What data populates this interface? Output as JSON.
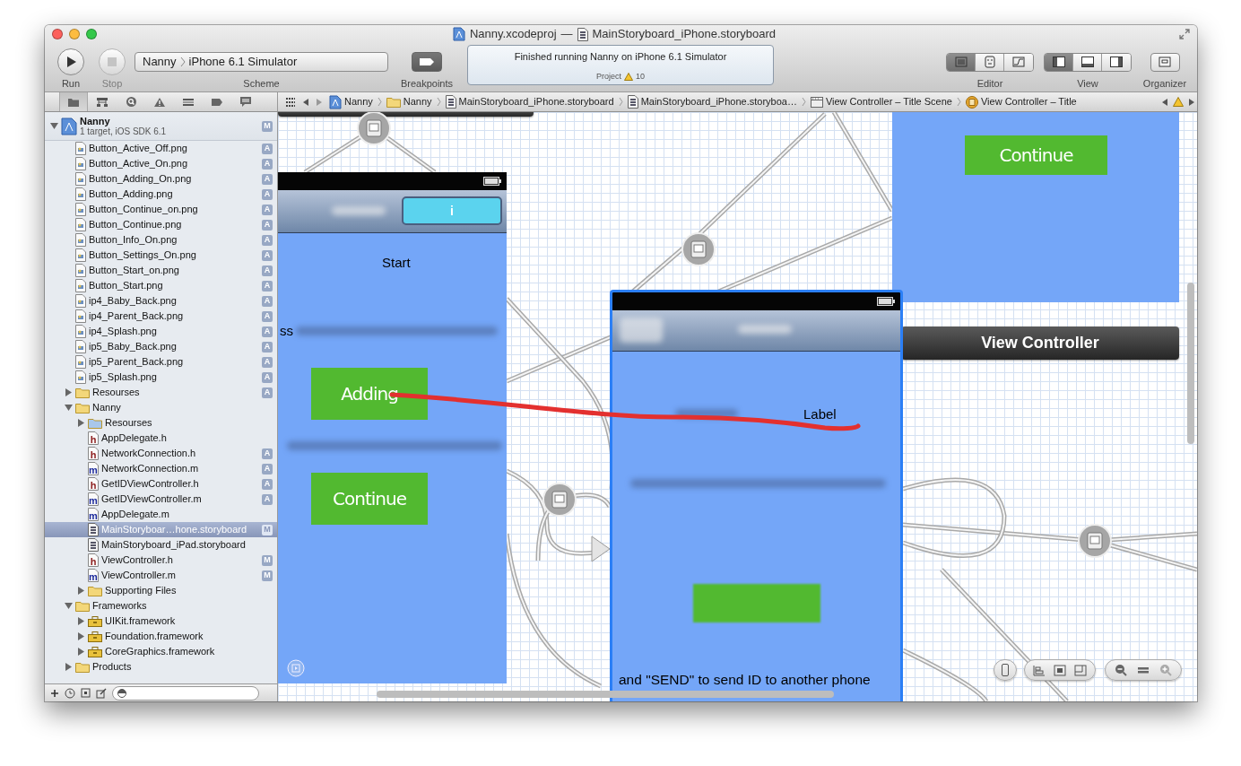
{
  "window": {
    "title": "Nanny.xcodeproj",
    "separator": "—",
    "document": "MainStoryboard_iPhone.storyboard"
  },
  "toolbar": {
    "run": {
      "label": "Run",
      "disabled": false
    },
    "stop": {
      "label": "Stop",
      "disabled": true
    },
    "scheme": {
      "project": "Nanny",
      "destination": "iPhone 6.1 Simulator",
      "label": "Scheme"
    },
    "breakpoints": {
      "label": "Breakpoints",
      "on": true
    },
    "activity": {
      "message": "Finished running Nanny on iPhone 6.1 Simulator",
      "project": "Project",
      "warnings": "10"
    },
    "editor": {
      "label": "Editor",
      "modes": [
        {
          "kind": "standard",
          "selected": true
        },
        {
          "kind": "assistant",
          "selected": false
        },
        {
          "kind": "version",
          "selected": false
        }
      ]
    },
    "view": {
      "label": "View",
      "panes": [
        {
          "kind": "navigator",
          "on": true
        },
        {
          "kind": "debug",
          "on": false
        },
        {
          "kind": "utilities",
          "on": false
        }
      ]
    },
    "organizer": {
      "label": "Organizer"
    }
  },
  "navigator_tabs": [
    {
      "kind": "project",
      "selected": true
    },
    {
      "kind": "symbol",
      "selected": false
    },
    {
      "kind": "search",
      "selected": false
    },
    {
      "kind": "issue",
      "selected": false
    },
    {
      "kind": "debug",
      "selected": false
    },
    {
      "kind": "breakpoint",
      "selected": false
    },
    {
      "kind": "log",
      "selected": false
    }
  ],
  "jump_bar": {
    "crumbs": [
      {
        "kind": "project",
        "label": "Nanny"
      },
      {
        "kind": "folder",
        "label": "Nanny"
      },
      {
        "kind": "storyboard",
        "label": "MainStoryboard_iPhone.storyboard"
      },
      {
        "kind": "storyboard",
        "label": "MainStoryboard_iPhone.storyboa…"
      },
      {
        "kind": "scene",
        "label": "View Controller – Title Scene"
      },
      {
        "kind": "controller",
        "label": "View Controller – Title"
      }
    ]
  },
  "navigator": {
    "project": {
      "name": "Nanny",
      "subtitle": "1 target, iOS SDK 6.1",
      "badge": "M",
      "expanded": true,
      "selected": false,
      "children": [
        {
          "name": "Button_Active_Off.png",
          "kind": "image",
          "badge": "A",
          "selected": false
        },
        {
          "name": "Button_Active_On.png",
          "kind": "image",
          "badge": "A",
          "selected": false
        },
        {
          "name": "Button_Adding_On.png",
          "kind": "image",
          "badge": "A",
          "selected": false
        },
        {
          "name": "Button_Adding.png",
          "kind": "image",
          "badge": "A",
          "selected": false
        },
        {
          "name": "Button_Continue_on.png",
          "kind": "image",
          "badge": "A",
          "selected": false
        },
        {
          "name": "Button_Continue.png",
          "kind": "image",
          "badge": "A",
          "selected": false
        },
        {
          "name": "Button_Info_On.png",
          "kind": "image",
          "badge": "A",
          "selected": false
        },
        {
          "name": "Button_Settings_On.png",
          "kind": "image",
          "badge": "A",
          "selected": false
        },
        {
          "name": "Button_Start_on.png",
          "kind": "image",
          "badge": "A",
          "selected": false
        },
        {
          "name": "Button_Start.png",
          "kind": "image",
          "badge": "A",
          "selected": false
        },
        {
          "name": "ip4_Baby_Back.png",
          "kind": "image",
          "badge": "A",
          "selected": false
        },
        {
          "name": "ip4_Parent_Back.png",
          "kind": "image",
          "badge": "A",
          "selected": false
        },
        {
          "name": "ip4_Splash.png",
          "kind": "image",
          "badge": "A",
          "selected": false
        },
        {
          "name": "ip5_Baby_Back.png",
          "kind": "image",
          "badge": "A",
          "selected": false
        },
        {
          "name": "ip5_Parent_Back.png",
          "kind": "image",
          "badge": "A",
          "selected": false
        },
        {
          "name": "ip5_Splash.png",
          "kind": "image",
          "badge": "A",
          "selected": false
        },
        {
          "name": "Resourses",
          "kind": "folder",
          "badge": "A",
          "expanded": false,
          "selected": false
        },
        {
          "name": "Nanny",
          "kind": "folder",
          "expanded": true,
          "selected": false,
          "children": [
            {
              "name": "Resourses",
              "kind": "blue-folder",
              "expanded": false,
              "selected": false
            },
            {
              "name": "AppDelegate.h",
              "kind": "source",
              "letter": "h",
              "color": "#8b1c1c",
              "selected": false
            },
            {
              "name": "NetworkConnection.h",
              "kind": "source",
              "letter": "h",
              "color": "#8b1c1c",
              "badge": "A",
              "selected": false
            },
            {
              "name": "NetworkConnection.m",
              "kind": "source",
              "letter": "m",
              "color": "#1c2a9b",
              "badge": "A",
              "selected": false
            },
            {
              "name": "GetIDViewController.h",
              "kind": "source",
              "letter": "h",
              "color": "#8b1c1c",
              "badge": "A",
              "selected": false
            },
            {
              "name": "GetIDViewController.m",
              "kind": "source",
              "letter": "m",
              "color": "#1c2a9b",
              "badge": "A",
              "selected": false
            },
            {
              "name": "AppDelegate.m",
              "kind": "source",
              "letter": "m",
              "color": "#1c2a9b",
              "selected": false
            },
            {
              "name": "MainStoryboar…hone.storyboard",
              "kind": "storyboard",
              "badge": "M",
              "selected": true
            },
            {
              "name": "MainStoryboard_iPad.storyboard",
              "kind": "storyboard",
              "selected": false
            },
            {
              "name": "ViewController.h",
              "kind": "source",
              "letter": "h",
              "color": "#8b1c1c",
              "badge": "M",
              "selected": false
            },
            {
              "name": "ViewController.m",
              "kind": "source",
              "letter": "m",
              "color": "#1c2a9b",
              "badge": "M",
              "selected": false
            },
            {
              "name": "Supporting Files",
              "kind": "folder",
              "expanded": false,
              "selected": false
            }
          ]
        },
        {
          "name": "Frameworks",
          "kind": "folder",
          "expanded": true,
          "selected": false,
          "children": [
            {
              "name": "UIKit.framework",
              "kind": "framework",
              "expanded": false,
              "selected": false
            },
            {
              "name": "Foundation.framework",
              "kind": "framework",
              "expanded": false,
              "selected": false
            },
            {
              "name": "CoreGraphics.framework",
              "kind": "framework",
              "expanded": false,
              "selected": false
            }
          ]
        },
        {
          "name": "Products",
          "kind": "folder",
          "expanded": false,
          "selected": false
        }
      ]
    }
  },
  "canvas": {
    "start_scene": {
      "info_button": "i",
      "title_label": "Start",
      "cut_label": "ss",
      "buttons": [
        "Adding",
        "Continue"
      ]
    },
    "top_scene": {
      "button": "Continue"
    },
    "scene_dock": {
      "title": "View Controller"
    },
    "selected_scene": {
      "selected": true,
      "label": "Label",
      "footer": "and \"SEND\" to send ID to another phone"
    }
  }
}
